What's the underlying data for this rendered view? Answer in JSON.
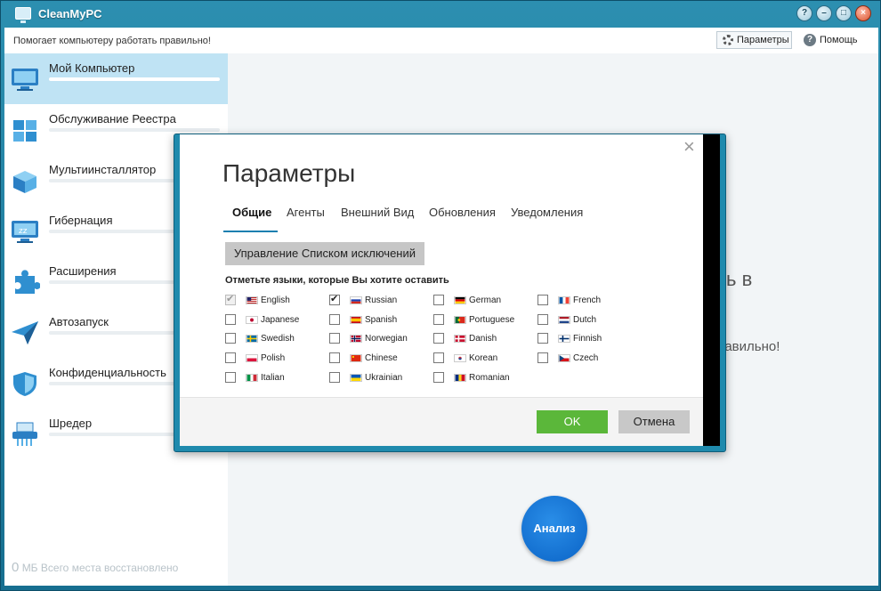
{
  "app": {
    "title": "CleanMyPC",
    "tagline": "Помогает компьютеру работать правильно!",
    "params_label": "Параметры",
    "help_label": "Помощь",
    "window_buttons": [
      "?",
      "–",
      "□",
      "×"
    ]
  },
  "sidebar": {
    "items": [
      {
        "label": "Мой Компьютер",
        "icon": "monitor-icon",
        "active": true
      },
      {
        "label": "Обслуживание Реестра",
        "icon": "registry-cubes-icon"
      },
      {
        "label": "Мультиинсталлятор",
        "icon": "box-icon"
      },
      {
        "label": "Гибернация",
        "icon": "sleep-monitor-icon"
      },
      {
        "label": "Расширения",
        "icon": "puzzle-icon"
      },
      {
        "label": "Автозапуск",
        "icon": "paper-plane-icon"
      },
      {
        "label": "Конфиденциальность",
        "icon": "shield-icon"
      },
      {
        "label": "Шредер",
        "icon": "shredder-icon"
      }
    ],
    "bottom_number": "0",
    "bottom_text": "МБ Всего места восстановлено"
  },
  "main": {
    "bg_text1": "ь в",
    "bg_text2": "равильно!",
    "analyze_label": "Анализ"
  },
  "modal": {
    "title": "Параметры",
    "close_glyph": "×",
    "tabs": [
      "Общие",
      "Агенты",
      "Внешний Вид",
      "Обновления",
      "Уведомления"
    ],
    "active_tab": "Общие",
    "exclusions_button": "Управление Списком исключений",
    "languages_label": "Отметьте языки, которые Вы хотите оставить",
    "languages": [
      {
        "name": "English",
        "checked": true,
        "disabled": true
      },
      {
        "name": "Russian",
        "checked": true
      },
      {
        "name": "German"
      },
      {
        "name": "French"
      },
      {
        "name": "Japanese"
      },
      {
        "name": "Spanish"
      },
      {
        "name": "Portuguese"
      },
      {
        "name": "Dutch"
      },
      {
        "name": "Swedish"
      },
      {
        "name": "Norwegian"
      },
      {
        "name": "Danish"
      },
      {
        "name": "Finnish"
      },
      {
        "name": "Polish"
      },
      {
        "name": "Chinese"
      },
      {
        "name": "Korean"
      },
      {
        "name": "Czech"
      },
      {
        "name": "Italian"
      },
      {
        "name": "Ukrainian"
      },
      {
        "name": "Romanian"
      }
    ],
    "ok_label": "OK",
    "cancel_label": "Отмена"
  },
  "colors": {
    "accent": "#1a7fb0",
    "ok_green": "#5bb73a",
    "analyze_blue": "#0a63c6",
    "sidebar_active": "#bfe3f4"
  }
}
